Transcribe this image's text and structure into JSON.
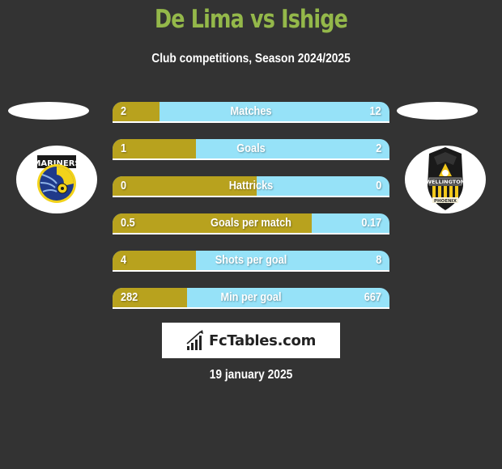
{
  "header": {
    "title": "De Lima vs Ishige",
    "subtitle": "Club competitions, Season 2024/2025"
  },
  "teams": {
    "left": {
      "name": "Central Coast Mariners",
      "logo_icon": "central-coast-mariners-crest-icon"
    },
    "right": {
      "name": "Wellington Phoenix",
      "logo_icon": "wellington-phoenix-crest-icon"
    }
  },
  "colors": {
    "background": "#333333",
    "title": "#94b84a",
    "left_bar": "#b8a21e",
    "right_bar": "#96e2f8"
  },
  "stats": [
    {
      "label": "Matches",
      "left": "2",
      "right": "12",
      "left_share": 0.17
    },
    {
      "label": "Goals",
      "left": "1",
      "right": "2",
      "left_share": 0.3
    },
    {
      "label": "Hattricks",
      "left": "0",
      "right": "0",
      "left_share": 0.52
    },
    {
      "label": "Goals per match",
      "left": "0.5",
      "right": "0.17",
      "left_share": 0.72
    },
    {
      "label": "Shots per goal",
      "left": "4",
      "right": "8",
      "left_share": 0.3
    },
    {
      "label": "Min per goal",
      "left": "282",
      "right": "667",
      "left_share": 0.27
    }
  ],
  "brand": {
    "name": "FcTables.com",
    "icon": "bar-chart-icon"
  },
  "footer": {
    "date": "19 january 2025"
  }
}
